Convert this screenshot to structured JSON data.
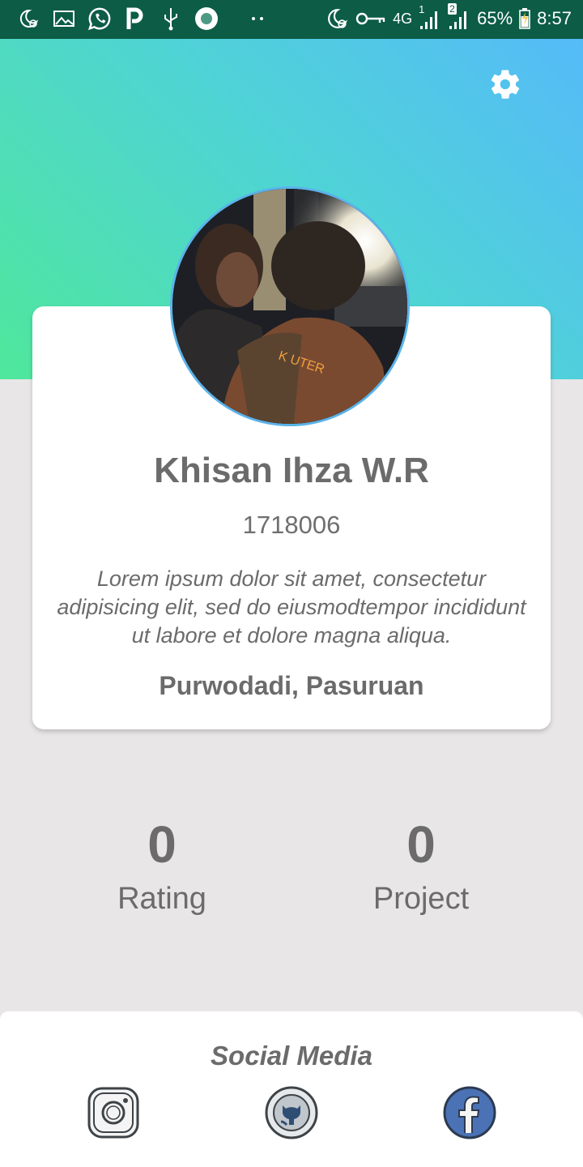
{
  "status_bar": {
    "network": "4G",
    "sim1": "1",
    "sim2": "2",
    "battery": "65%",
    "time": "8:57",
    "icons": [
      "moon-alarm-icon",
      "image-icon",
      "whatsapp-icon",
      "p-icon",
      "usb-icon",
      "circle-app-icon",
      "dots-icon",
      "moon-alarm-icon",
      "key-icon",
      "signal-icon",
      "battery-icon"
    ]
  },
  "header": {
    "settings_icon": "gear-icon",
    "gradient": [
      "#55bbf8",
      "#4fd3d6",
      "#4fe79c"
    ]
  },
  "profile": {
    "name": "Khisan Ihza W.R",
    "id": "1718006",
    "bio": "Lorem ipsum dolor sit amet, consectetur adipisicing elit, sed do eiusmodtempor incididunt ut labore et dolore magna aliqua.",
    "location": "Purwodadi, Pasuruan"
  },
  "stats": {
    "rating_value": "0",
    "rating_label": "Rating",
    "project_value": "0",
    "project_label": "Project"
  },
  "social": {
    "title": "Social Media",
    "icons": [
      "instagram-icon",
      "github-icon",
      "facebook-icon"
    ]
  },
  "colors": {
    "status_bar": "#0c5c46",
    "background": "#e8e6e7",
    "text": "#6b6b6b",
    "avatar_border": "#5ab3ea"
  }
}
